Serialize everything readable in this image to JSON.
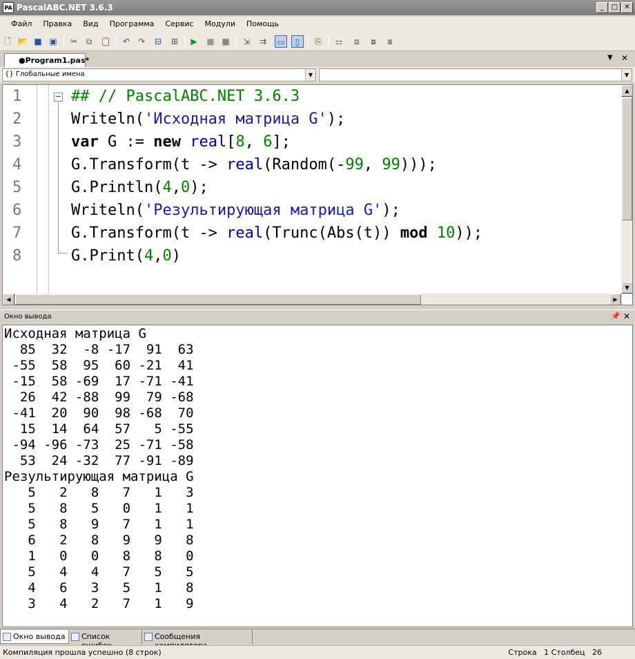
{
  "window": {
    "title": "PascalABC.NET 3.6.3",
    "icon_text": "PA"
  },
  "menu": [
    "Файл",
    "Правка",
    "Вид",
    "Программа",
    "Сервис",
    "Модули",
    "Помощь"
  ],
  "toolbar_icons": [
    "new-file-icon",
    "open-icon",
    "save-icon",
    "save-all-icon",
    "cut-icon",
    "copy-icon",
    "paste-icon",
    "undo-icon",
    "redo-icon",
    "find-icon",
    "replace-icon",
    "run-icon",
    "stop-icon",
    "compile-icon",
    "step-into-icon",
    "step-over-icon",
    "output-toggle-icon",
    "console-toggle-icon",
    "format-icon",
    "form-designer-icon",
    "debug-icon",
    "debug-stop-icon",
    "debug-continue-icon"
  ],
  "doc_tab": {
    "label": "●Program1.pas*"
  },
  "combos": {
    "left": "{} Глобальные имена",
    "right": ""
  },
  "editor": {
    "line_numbers": [
      "1",
      "2",
      "3",
      "4",
      "5",
      "6",
      "7",
      "8"
    ],
    "lines": [
      [
        {
          "t": "## // PascalABC.NET 3.6.3",
          "c": "cm"
        }
      ],
      [
        {
          "t": "Writeln(",
          "c": ""
        },
        {
          "t": "'Исходная матрица G'",
          "c": "st"
        },
        {
          "t": ");",
          "c": ""
        }
      ],
      [
        {
          "t": "var",
          "c": "kw"
        },
        {
          "t": " G := ",
          "c": ""
        },
        {
          "t": "new",
          "c": "kw"
        },
        {
          "t": " ",
          "c": ""
        },
        {
          "t": "real",
          "c": "ty"
        },
        {
          "t": "[",
          "c": ""
        },
        {
          "t": "8",
          "c": "nm"
        },
        {
          "t": ", ",
          "c": ""
        },
        {
          "t": "6",
          "c": "nm"
        },
        {
          "t": "];",
          "c": ""
        }
      ],
      [
        {
          "t": "G.Transform(t -> ",
          "c": ""
        },
        {
          "t": "real",
          "c": "ty"
        },
        {
          "t": "(Random(-",
          "c": ""
        },
        {
          "t": "99",
          "c": "nm"
        },
        {
          "t": ", ",
          "c": ""
        },
        {
          "t": "99",
          "c": "nm"
        },
        {
          "t": ")));",
          "c": ""
        }
      ],
      [
        {
          "t": "G.Println(",
          "c": ""
        },
        {
          "t": "4",
          "c": "nm"
        },
        {
          "t": ",",
          "c": ""
        },
        {
          "t": "0",
          "c": "nm"
        },
        {
          "t": ");",
          "c": ""
        }
      ],
      [
        {
          "t": "Writeln(",
          "c": ""
        },
        {
          "t": "'Результирующая матрица G'",
          "c": "st"
        },
        {
          "t": ");",
          "c": ""
        }
      ],
      [
        {
          "t": "G.Transform(t -> ",
          "c": ""
        },
        {
          "t": "real",
          "c": "ty"
        },
        {
          "t": "(Trunc(Abs(t)) ",
          "c": ""
        },
        {
          "t": "mod",
          "c": "kw"
        },
        {
          "t": " ",
          "c": ""
        },
        {
          "t": "10",
          "c": "nm"
        },
        {
          "t": "));",
          "c": ""
        }
      ],
      [
        {
          "t": "G.Print(",
          "c": ""
        },
        {
          "t": "4",
          "c": "nm"
        },
        {
          "t": ",",
          "c": ""
        },
        {
          "t": "0",
          "c": "nm"
        },
        {
          "t": ")",
          "c": ""
        }
      ]
    ]
  },
  "output_panel": {
    "title": "Окно вывода"
  },
  "output": {
    "lines": [
      {
        "t": "Исходная матрица G",
        "c": ""
      },
      {
        "t": "  85  32  -8 -17  91  63",
        "c": ""
      },
      {
        "t": " -55  58  95  60 -21  41",
        "c": ""
      },
      {
        "t": " -15  58 -69  17 -71 -41",
        "c": ""
      },
      {
        "t": "  26  42 -88  99  79 -68",
        "c": ""
      },
      {
        "t": " -41  20  90  98 -68  70",
        "c": ""
      },
      {
        "t": "  15  14  64  57   5 -55",
        "c": ""
      },
      {
        "t": " -94 -96 -73  25 -71 -58",
        "c": ""
      },
      {
        "t": "  53  24 -32  77 -91 -89",
        "c": ""
      },
      {
        "t": "Результирующая матрица G",
        "c": ""
      },
      {
        "t": "   5   2   8   7   1   3",
        "c": ""
      },
      {
        "t": "   5   8   5   0   1   1",
        "c": ""
      },
      {
        "t": "   5   8   9   7   1   1",
        "c": ""
      },
      {
        "t": "   6   2   8   9   9   8",
        "c": ""
      },
      {
        "t": "   1   0   0   8   8   0",
        "c": ""
      },
      {
        "t": "   5   4   4   7   5   5",
        "c": ""
      },
      {
        "t": "   4   6   3   5   1   8",
        "c": ""
      },
      {
        "t": "   3   4   2   7   1   9",
        "c": ""
      }
    ]
  },
  "bottom_tabs": [
    "Окно вывода",
    "Список ошибок",
    "Сообщения компилятора"
  ],
  "status": {
    "left": "Компиляция прошла успешно (8 строк)",
    "row_label": "Строка",
    "row": "1",
    "col_label": "Столбец",
    "col": "26"
  }
}
